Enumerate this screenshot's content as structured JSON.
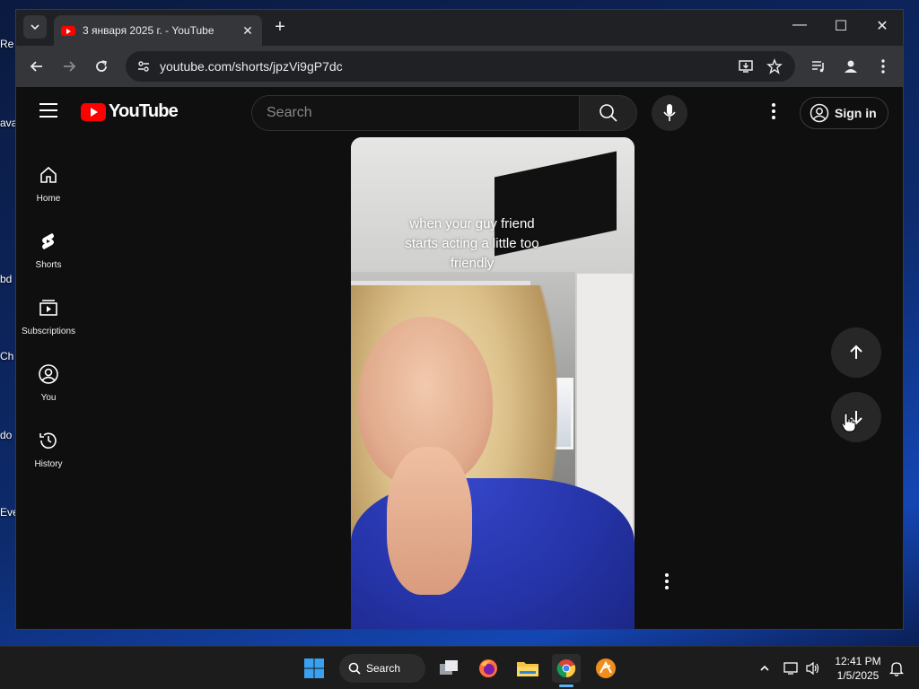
{
  "desktop": {
    "icons": [
      {
        "label": "Re"
      },
      {
        "label": "ava"
      },
      {
        "label": "bd"
      },
      {
        "label": "Ch"
      },
      {
        "label": "do"
      },
      {
        "label": "Eve"
      }
    ]
  },
  "browser": {
    "tab_title": "3 января 2025 г. - YouTube",
    "tab_close": "✕",
    "new_tab": "+",
    "window_controls": {
      "minimize": "—",
      "maximize": "☐",
      "close": "✕"
    },
    "url": "youtube.com/shorts/jpzVi9gP7dc"
  },
  "youtube": {
    "logo_text": "YouTube",
    "search_placeholder": "Search",
    "signin_label": "Sign in",
    "guide": [
      {
        "label": "Home",
        "icon": "home-icon"
      },
      {
        "label": "Shorts",
        "icon": "shorts-icon"
      },
      {
        "label": "Subscriptions",
        "icon": "subscriptions-icon"
      },
      {
        "label": "You",
        "icon": "you-icon"
      },
      {
        "label": "History",
        "icon": "history-icon"
      }
    ],
    "short": {
      "caption_line1": "when your guy friend",
      "caption_line2": "starts acting a little too",
      "caption_line3": "friendly"
    }
  },
  "taskbar": {
    "search_label": "Search",
    "time": "12:41 PM",
    "date": "1/5/2025",
    "accent": "#5fb2f2"
  },
  "colors": {
    "youtube_red": "#ff0000",
    "page_bg": "#0f0f0f",
    "hoodie_blue": "#2534a8"
  }
}
